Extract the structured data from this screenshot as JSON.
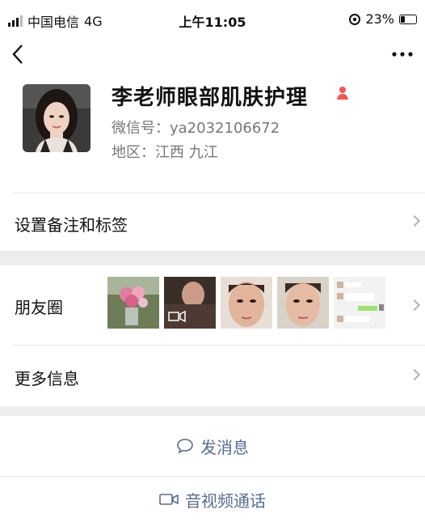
{
  "status_bar": {
    "carrier": "中国电信",
    "network": "4G",
    "time": "上午11:05",
    "battery": "23%"
  },
  "nav": {
    "back_icon": "chevron-left-icon",
    "more_icon": "more-dots-icon"
  },
  "profile": {
    "name": "李老师眼部肌肤护理",
    "wechat_id": "微信号：ya2032106672",
    "region": "地区：江西 九江",
    "gender_icon": "female-icon",
    "gender_color": "#fa5151"
  },
  "rows": {
    "remark": "设置备注和标签",
    "moments": "朋友圈",
    "more_info": "更多信息"
  },
  "actions": {
    "message": "发消息",
    "call": "音视频通话",
    "link_color": "#576b95"
  }
}
